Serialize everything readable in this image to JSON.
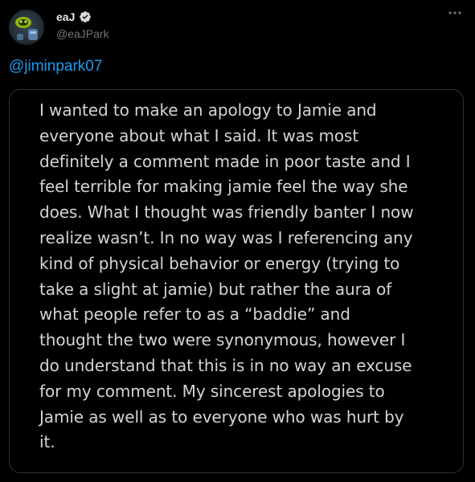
{
  "tweet": {
    "author": {
      "display_name": "eaJ",
      "handle": "@eaJPark",
      "verified": true,
      "avatar_icon": "avatar-photo"
    },
    "more_icon": "more-horizontal-icon",
    "mention_text": "@jiminpark07",
    "image_text_lines": [
      "I wanted to make an apology to Jamie and",
      "everyone about what I said. It was most",
      "definitely a comment made in poor taste and I",
      "feel terrible for making jamie feel the way she",
      "does. What I thought was friendly banter I now",
      "realize wasn’t. In no way was I referencing any",
      "kind of physical behavior or energy (trying to",
      "take a slight at jamie) but rather the aura of",
      "what people refer to as a “baddie” and",
      "thought the two were synonymous, however I",
      "do understand that this is in no way an excuse",
      "for my comment. My sincerest apologies to",
      "Jamie as well as to everyone who was hurt by",
      "it."
    ]
  },
  "colors": {
    "background": "#000000",
    "primary_text": "#e7e9ea",
    "secondary_text": "#71767b",
    "link": "#1d9bf0",
    "verified_badge": "#d9d9d9",
    "card_border": "#2f3336",
    "image_text": "#d4d4d4"
  }
}
